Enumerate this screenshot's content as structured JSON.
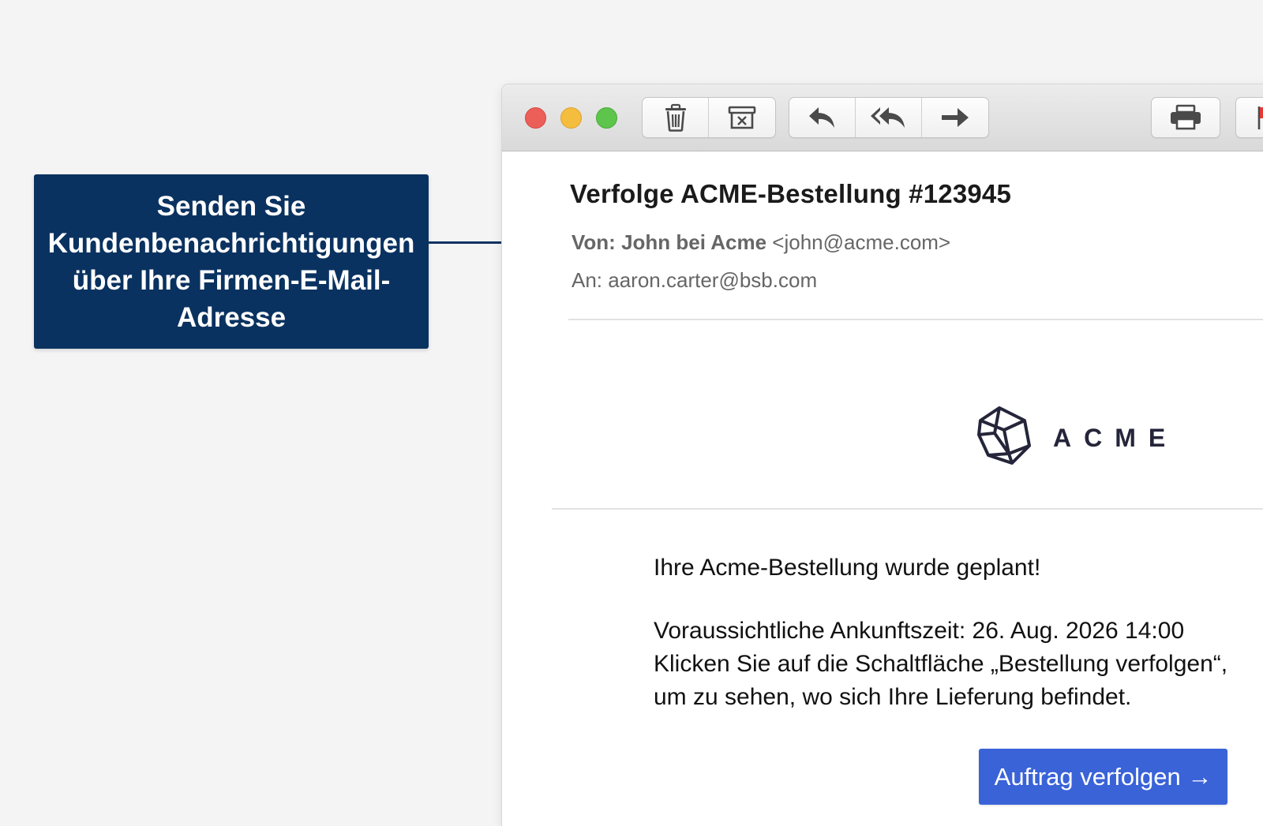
{
  "callout": {
    "line1": "Senden Sie",
    "line2": "Kundenbenachrichtigungen",
    "line3": "über Ihre Firmen-E-Mail-",
    "line4": "Adresse"
  },
  "toolbar": {
    "buttons": [
      {
        "icon": "trash-icon"
      },
      {
        "icon": "archive-icon"
      },
      {
        "icon": "reply-icon"
      },
      {
        "icon": "reply-all-icon"
      },
      {
        "icon": "forward-icon"
      },
      {
        "icon": "print-icon"
      },
      {
        "icon": "flag-icon"
      }
    ],
    "colors": {
      "close": "#ec5f58",
      "minimize": "#f4bd3d",
      "zoom": "#5dc44c",
      "flag": "#e53935"
    }
  },
  "email": {
    "subject": "Verfolge ACME-Bestellung #123945",
    "from_label": "Von:",
    "from_name": "John bei Acme",
    "from_address": "<john@acme.com>",
    "to_label": "An:",
    "to_address": "aaron.carter@bsb.com"
  },
  "logo": {
    "text": "ACME",
    "icon": "cube-icon",
    "color": "#25253a"
  },
  "body": {
    "headline": "Ihre Acme-Bestellung wurde geplant!",
    "eta": "Voraussichtliche Ankunftszeit: 26. Aug. 2026 14:00",
    "instruction_line1": "Klicken Sie auf die Schaltfläche „Bestellung verfolgen“,",
    "instruction_line2": "um zu sehen, wo sich Ihre Lieferung befindet."
  },
  "cta": {
    "label": "Auftrag verfolgen →",
    "color": "#3a63d8"
  },
  "theme": {
    "callout_bg": "#0a3260",
    "page_bg": "#f4f4f5"
  }
}
